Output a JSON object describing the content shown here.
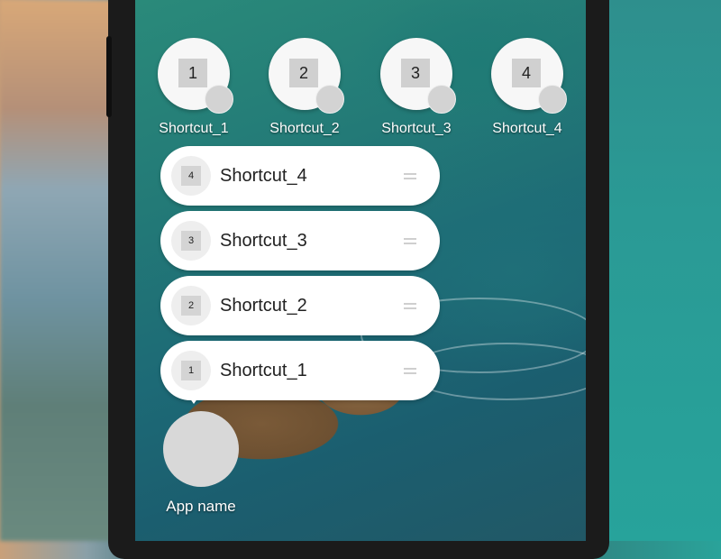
{
  "shortcut_grid": [
    {
      "number": "1",
      "label": "Shortcut_1"
    },
    {
      "number": "2",
      "label": "Shortcut_2"
    },
    {
      "number": "3",
      "label": "Shortcut_3"
    },
    {
      "number": "4",
      "label": "Shortcut_4"
    }
  ],
  "shortcut_menu": [
    {
      "number": "4",
      "label": "Shortcut_4"
    },
    {
      "number": "3",
      "label": "Shortcut_3"
    },
    {
      "number": "2",
      "label": "Shortcut_2"
    },
    {
      "number": "1",
      "label": "Shortcut_1"
    }
  ],
  "app": {
    "label": "App name"
  },
  "icons": {
    "drag_handle": "drag-handle-icon",
    "badge": "badge-icon"
  },
  "colors": {
    "menu_bg": "#ffffff",
    "icon_placeholder": "#d0d0d0",
    "label_text": "#ffffff"
  }
}
